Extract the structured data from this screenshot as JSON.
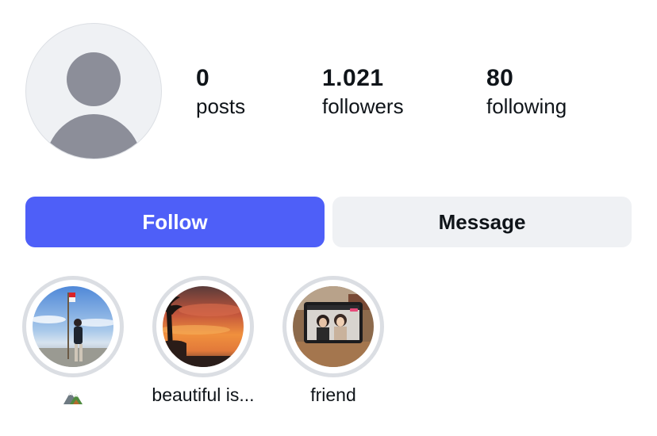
{
  "profile": {
    "avatar_icon": "default-avatar-icon",
    "colors": {
      "avatar_bg": "#eff1f4",
      "avatar_silhouette": "#8c8e99"
    }
  },
  "stats": {
    "posts": {
      "value": "0",
      "label": "posts"
    },
    "followers": {
      "value": "1.021",
      "label": "followers"
    },
    "following": {
      "value": "80",
      "label": "following"
    }
  },
  "actions": {
    "follow_label": "Follow",
    "message_label": "Message",
    "colors": {
      "follow_bg": "#4e5ff8",
      "follow_text": "#ffffff",
      "message_bg": "#eff1f4",
      "message_text": "#0f1419"
    }
  },
  "highlights": [
    {
      "label_icon": "mountain-emoji-icon",
      "thumbnail": "person-with-flag-on-summit"
    },
    {
      "label": "beautiful is...",
      "thumbnail": "sunset-with-palm"
    },
    {
      "label": "friend",
      "thumbnail": "two-friends-on-tablet-screen"
    }
  ]
}
